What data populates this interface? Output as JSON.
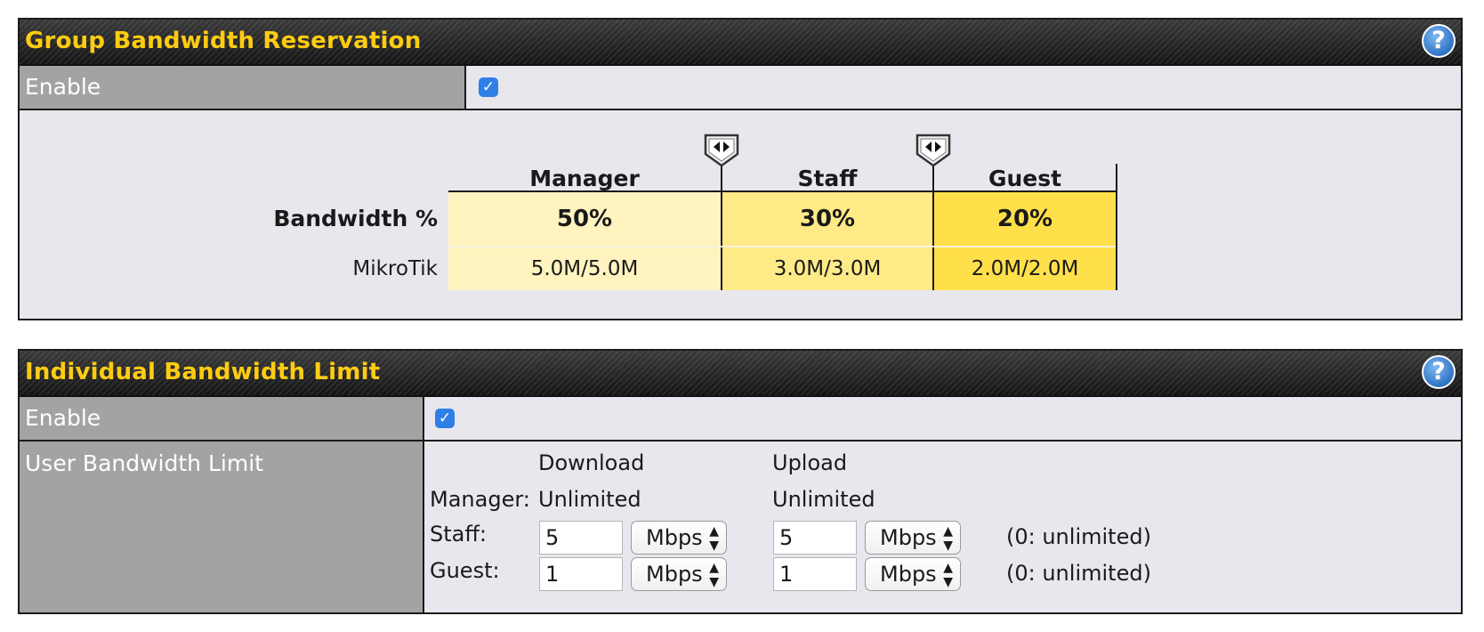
{
  "group_panel": {
    "title": "Group Bandwidth Reservation",
    "help_icon": "?",
    "enable_label": "Enable",
    "enable_checked": true,
    "columns": [
      {
        "name": "Manager",
        "percent": "50%",
        "rate": "5.0M/5.0M",
        "color": "#fff3bf"
      },
      {
        "name": "Staff",
        "percent": "30%",
        "rate": "3.0M/3.0M",
        "color": "#ffea88"
      },
      {
        "name": "Guest",
        "percent": "20%",
        "rate": "2.0M/2.0M",
        "color": "#ffe04a"
      }
    ],
    "row_bandwidth_label": "Bandwidth %",
    "row_device_label": "MikroTik"
  },
  "individual_panel": {
    "title": "Individual Bandwidth Limit",
    "help_icon": "?",
    "enable_label": "Enable",
    "enable_checked": true,
    "limit_label": "User Bandwidth Limit",
    "download_header": "Download",
    "upload_header": "Upload",
    "manager": {
      "label": "Manager:",
      "download": "Unlimited",
      "upload": "Unlimited"
    },
    "staff": {
      "label": "Staff:",
      "download_value": "5",
      "download_unit": "Mbps",
      "upload_value": "5",
      "upload_unit": "Mbps",
      "hint": "(0: unlimited)"
    },
    "guest": {
      "label": "Guest:",
      "download_value": "1",
      "download_unit": "Mbps",
      "upload_value": "1",
      "upload_unit": "Mbps",
      "hint": "(0: unlimited)"
    }
  },
  "colors": {
    "title_yellow": "#ffcc11",
    "label_gray": "#a3a3a3",
    "checkbox_blue": "#2f7fe6"
  }
}
